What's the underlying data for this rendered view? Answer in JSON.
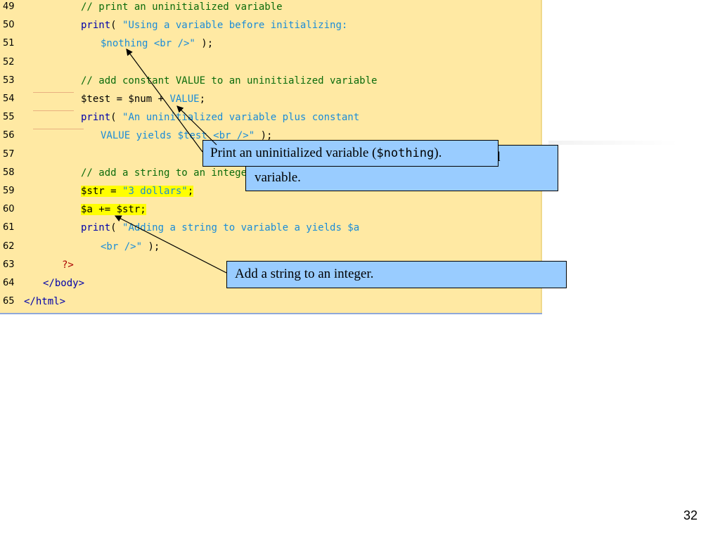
{
  "code_lines": [
    {
      "num": "49",
      "indent": 115,
      "parts": [
        {
          "t": "// print an uninitialized variable",
          "c": "cm"
        }
      ]
    },
    {
      "num": "50",
      "indent": 115,
      "parts": [
        {
          "t": "print",
          "c": "kw"
        },
        {
          "t": "( ",
          "c": "var"
        },
        {
          "t": "\"Using a variable before initializing:",
          "c": "str"
        }
      ]
    },
    {
      "num": "51",
      "indent": 143,
      "parts": [
        {
          "t": "$nothing <br />\"",
          "c": "str"
        },
        {
          "t": " );",
          "c": "var"
        }
      ]
    },
    {
      "num": "52",
      "indent": 115,
      "parts": []
    },
    {
      "num": "53",
      "indent": 115,
      "parts": [
        {
          "t": "// add constant VALUE to an uninitialized variable",
          "c": "cm"
        }
      ]
    },
    {
      "num": "54",
      "indent": 115,
      "parts": [
        {
          "t": "$test = $num + ",
          "c": "var"
        },
        {
          "t": "VALUE",
          "c": "str"
        },
        {
          "t": ";",
          "c": "var"
        }
      ]
    },
    {
      "num": "55",
      "indent": 115,
      "parts": [
        {
          "t": "print",
          "c": "kw"
        },
        {
          "t": "( ",
          "c": "var"
        },
        {
          "t": "\"An uninitialized variable plus constant",
          "c": "str"
        }
      ]
    },
    {
      "num": "56",
      "indent": 143,
      "parts": [
        {
          "t": "VALUE yields $test <br />\"",
          "c": "str"
        },
        {
          "t": " );",
          "c": "var"
        }
      ]
    },
    {
      "num": "57",
      "indent": 115,
      "parts": []
    },
    {
      "num": "58",
      "indent": 115,
      "parts": [
        {
          "t": "// add a string to an integer",
          "c": "cm"
        }
      ]
    },
    {
      "num": "59",
      "indent": 115,
      "parts": [
        {
          "t": "$str = ",
          "c": "var",
          "h": true
        },
        {
          "t": "\"3 dollars\"",
          "c": "str",
          "h": true
        },
        {
          "t": ";",
          "c": "var",
          "h": true
        }
      ]
    },
    {
      "num": "60",
      "indent": 115,
      "parts": [
        {
          "t": "$a += $str;",
          "c": "var",
          "h": true
        }
      ]
    },
    {
      "num": "61",
      "indent": 115,
      "parts": [
        {
          "t": "print",
          "c": "kw"
        },
        {
          "t": "( ",
          "c": "var"
        },
        {
          "t": "\"Adding a string to variable a yields $a",
          "c": "str"
        }
      ]
    },
    {
      "num": "62",
      "indent": 143,
      "parts": [
        {
          "t": "<br />\"",
          "c": "str"
        },
        {
          "t": " );",
          "c": "var"
        }
      ]
    },
    {
      "num": "63",
      "indent": 88,
      "parts": [
        {
          "t": "?>",
          "c": "php"
        }
      ]
    },
    {
      "num": "64",
      "indent": 61,
      "parts": [
        {
          "t": "</body>",
          "c": "tag"
        }
      ]
    },
    {
      "num": "65",
      "indent": 34,
      "parts": [
        {
          "t": "</html>",
          "c": "tag"
        }
      ]
    }
  ],
  "callouts": {
    "uninit_var": {
      "pre": "Print an uninitialized variable (",
      "mono": "$nothing",
      "post": ")."
    },
    "hidden_fragment": {
      "line1_tail": "d",
      "line2": "variable."
    },
    "add_string": {
      "text": "Add a string to an integer."
    }
  },
  "page_number": "32",
  "colors": {
    "code_bg": "#ffe9a3",
    "callout_bg": "#99ccff",
    "highlight": "#ffff00"
  }
}
